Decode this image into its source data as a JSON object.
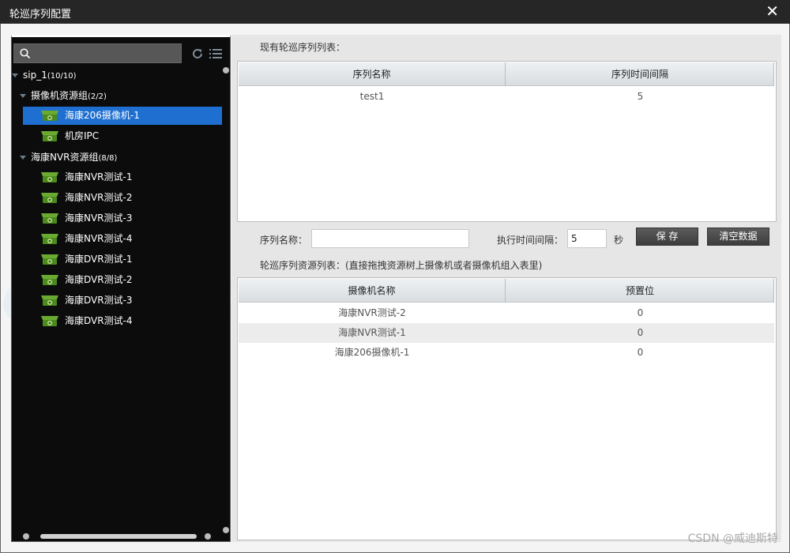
{
  "window": {
    "title": "轮巡序列配置",
    "close_symbol": "✕"
  },
  "tree": {
    "root": {
      "label": "sip_1",
      "count": "(10/10)"
    },
    "groups": [
      {
        "label": "摄像机资源组",
        "count": "(2/2)",
        "items": [
          {
            "label": "海康206摄像机-1",
            "selected": true
          },
          {
            "label": "机房IPC",
            "selected": false
          }
        ]
      },
      {
        "label": "海康NVR资源组",
        "count": "(8/8)",
        "items": [
          {
            "label": "海康NVR测试-1"
          },
          {
            "label": "海康NVR测试-2"
          },
          {
            "label": "海康NVR测试-3"
          },
          {
            "label": "海康NVR测试-4"
          },
          {
            "label": "海康DVR测试-1"
          },
          {
            "label": "海康DVR测试-2"
          },
          {
            "label": "海康DVR测试-3"
          },
          {
            "label": "海康DVR测试-4"
          }
        ]
      }
    ]
  },
  "sequence_list": {
    "label": "现有轮巡序列列表：",
    "columns": [
      "序列名称",
      "序列时间间隔"
    ],
    "rows": [
      [
        "test1",
        "5"
      ]
    ]
  },
  "form": {
    "name_label": "序列名称：",
    "name_value": "",
    "interval_label": "执行时间间隔：",
    "interval_value": "5",
    "unit": "秒",
    "save_label": "保    存",
    "clear_label": "清空数据"
  },
  "resource_list": {
    "label": "轮巡序列资源列表：(直接拖拽资源树上摄像机或者摄像机组入表里)",
    "columns": [
      "摄像机名称",
      "预置位"
    ],
    "rows": [
      [
        "海康NVR测试-2",
        "0"
      ],
      [
        "海康NVR测试-1",
        "0"
      ],
      [
        "海康206摄像机-1",
        "0"
      ]
    ]
  },
  "watermark": "ei, vidisit.cn , vi",
  "footer": "CSDN @威迪斯特",
  "colors": {
    "selected": "#1e6fd0",
    "tree_bg": "#0c0c0c",
    "camera_icon": "#5a9a2a"
  }
}
